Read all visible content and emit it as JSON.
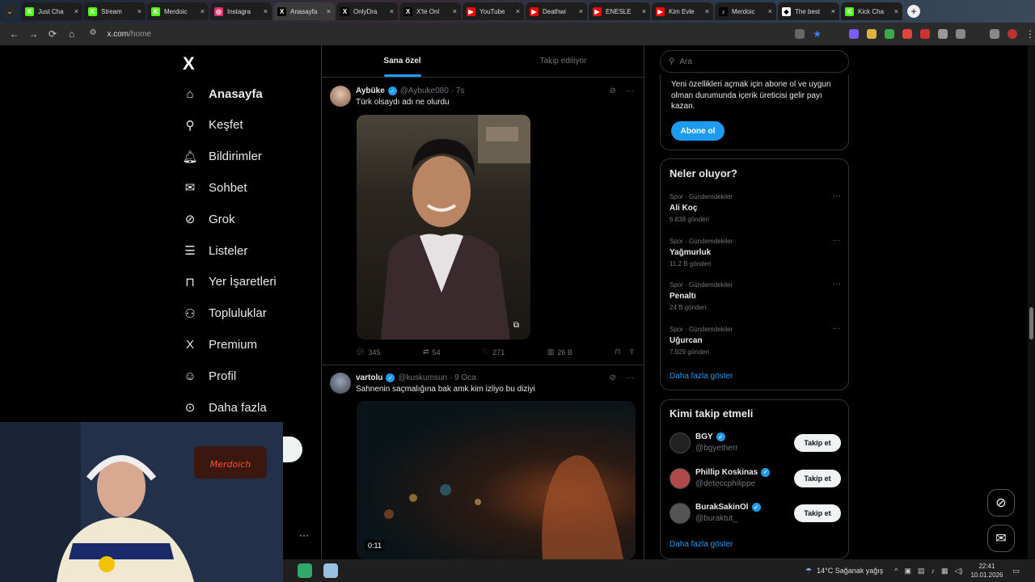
{
  "browser": {
    "tabs": [
      {
        "label": "Just Cha",
        "color": "#53fc18",
        "glyph": "K"
      },
      {
        "label": "Stream",
        "color": "#53fc18",
        "glyph": "K"
      },
      {
        "label": "Merdoic",
        "color": "#53fc18",
        "glyph": "K"
      },
      {
        "label": "Instagra",
        "color": "#e1306c",
        "glyph": "◎"
      },
      {
        "label": "Anasayfa",
        "color": "#000000",
        "glyph": "X",
        "active": true
      },
      {
        "label": "OnlyDra",
        "color": "#000000",
        "glyph": "X"
      },
      {
        "label": "X'te Onl",
        "color": "#000000",
        "glyph": "X"
      },
      {
        "label": "YouTube",
        "color": "#ff0000",
        "glyph": "▶"
      },
      {
        "label": "Deathwi",
        "color": "#ff0000",
        "glyph": "▶"
      },
      {
        "label": "ENESLE",
        "color": "#ff0000",
        "glyph": "▶"
      },
      {
        "label": "Kim Evle",
        "color": "#ff0000",
        "glyph": "▶"
      },
      {
        "label": "Merdoic",
        "color": "#000000",
        "glyph": "♪"
      },
      {
        "label": "The best",
        "color": "#ffffff",
        "glyph": "◆"
      },
      {
        "label": "Kick Cha",
        "color": "#53fc18",
        "glyph": "K"
      }
    ],
    "url_host": "x.com",
    "url_path": "/home"
  },
  "sidebar": {
    "logo": "X",
    "items": [
      {
        "label": "Anasayfa",
        "icon": "home-icon",
        "active": true
      },
      {
        "label": "Keşfet",
        "icon": "search-icon"
      },
      {
        "label": "Bildirimler",
        "icon": "bell-icon"
      },
      {
        "label": "Sohbet",
        "icon": "mail-icon"
      },
      {
        "label": "Grok",
        "icon": "grok-icon"
      },
      {
        "label": "Listeler",
        "icon": "list-icon"
      },
      {
        "label": "Yer İşaretleri",
        "icon": "bookmark-icon"
      },
      {
        "label": "Topluluklar",
        "icon": "community-icon"
      },
      {
        "label": "Premium",
        "icon": "x-icon"
      },
      {
        "label": "Profil",
        "icon": "profile-icon"
      },
      {
        "label": "Daha fazla",
        "icon": "more-icon"
      }
    ]
  },
  "feed": {
    "tabs": [
      "Sana özel",
      "Takip ediliyor"
    ],
    "post1": {
      "name": "Aybüke",
      "handle": "@Aybuke080",
      "time": "· 7s",
      "text": "Türk olsaydı adı ne olurdu",
      "replies": "345",
      "reposts": "54",
      "likes": "271",
      "views": "26 B"
    },
    "post2": {
      "name": "vartolu",
      "handle": "@kuskumsun",
      "time": "· 9 Oca",
      "text": "Sahnenin saçmalığına bak amk kim izliyo bu diziyi",
      "video_time": "0:11"
    }
  },
  "right": {
    "search_placeholder": "Ara",
    "premium_text": "Yeni özellikleri açmak için abone ol ve uygun olman durumunda içerik üreticisi gelir payı kazan.",
    "premium_button": "Abone ol",
    "trends_title": "Neler oluyor?",
    "trends": [
      {
        "category": "Spor · Gündemdekiler",
        "name": "Ali Koç",
        "count": "6.838 gönderi"
      },
      {
        "category": "Spor · Gündemdekiler",
        "name": "Yağmurluk",
        "count": "11,2 B gönderi"
      },
      {
        "category": "Spor · Gündemdekiler",
        "name": "Penaltı",
        "count": "24 B gönderi"
      },
      {
        "category": "Spor · Gündemdekiler",
        "name": "Uğurcan",
        "count": "7.929 gönderi"
      }
    ],
    "show_more": "Daha fazla göster",
    "follow_title": "Kimi takip etmeli",
    "follows": [
      {
        "name": "BGY",
        "handle": "@bgyetherr",
        "button": "Takip et"
      },
      {
        "name": "Phillip Koskinas",
        "handle": "@deteccphilippe",
        "button": "Takip et"
      },
      {
        "name": "BurakSakinOl",
        "handle": "@buraktut_",
        "button": "Takip et"
      }
    ]
  },
  "taskbar": {
    "weather": "14°C  Sağanak yağış",
    "time": "22:41",
    "date": "10.01.2026"
  }
}
